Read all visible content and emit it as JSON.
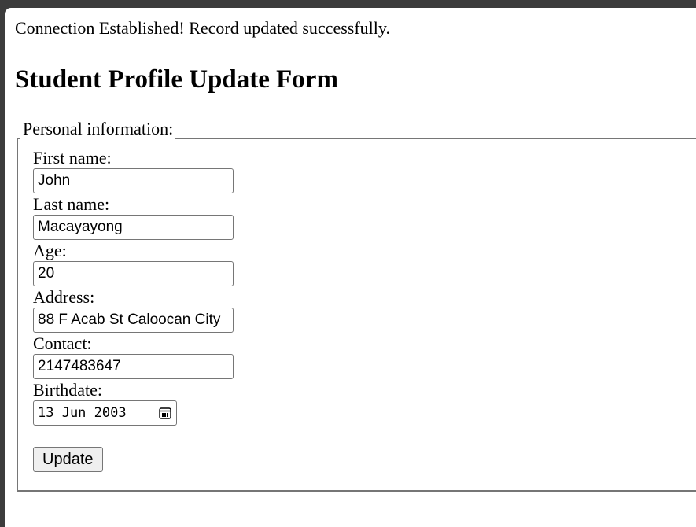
{
  "status_message": "Connection Established! Record updated successfully.",
  "form": {
    "title": "Student Profile Update Form",
    "legend": "Personal information:",
    "fields": {
      "first_name": {
        "label": "First name:",
        "value": "John"
      },
      "last_name": {
        "label": "Last name:",
        "value": "Macayayong"
      },
      "age": {
        "label": "Age:",
        "value": "20"
      },
      "address": {
        "label": "Address:",
        "value": "88 F Acab St Caloocan City"
      },
      "contact": {
        "label": "Contact:",
        "value": "2147483647"
      },
      "birthdate": {
        "label": "Birthdate:",
        "value": "13 Jun 2003",
        "icon": "calendar-icon"
      }
    },
    "submit_label": "Update"
  }
}
